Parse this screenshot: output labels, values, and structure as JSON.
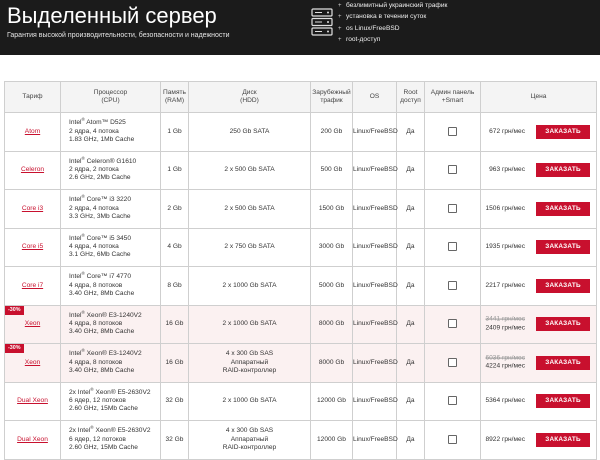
{
  "header": {
    "title": "Выделенный сервер",
    "subtitle": "Гарантия высокой производительности, безопасности и надежности",
    "icon": "server-icon",
    "features": [
      "безлимитный украинский трафик",
      "установка в течении суток",
      "os Linux/FreeBSD",
      "root-доступ"
    ]
  },
  "table": {
    "headers": {
      "tariff": "Тариф",
      "cpu": [
        "Процессор",
        "(CPU)"
      ],
      "ram": [
        "Память",
        "(RAM)"
      ],
      "hdd": [
        "Диск",
        "(HDD)"
      ],
      "traffic": [
        "Зарубежный",
        "трафик"
      ],
      "os": "OS",
      "root": [
        "Root",
        "доступ"
      ],
      "admin": [
        "Админ панель",
        "+Smart"
      ],
      "price": "Цена"
    },
    "order_label": "ЗАКАЗАТЬ",
    "rows": [
      {
        "tariff": "Atom",
        "discount": "",
        "cpu_brand": "Intel",
        "cpu_model": "Atom™ D525",
        "cpu_cores": "2 ядра, 4 потока",
        "cpu_freq": "1.83 GHz, 1Mb Cache",
        "ram": "1 Gb",
        "hdd": [
          "250 Gb SATA"
        ],
        "traffic": "200 Gb",
        "os": "Linux/FreeBSD",
        "root": "Да",
        "old_price": "",
        "price": "672 грн/мес",
        "highlight": false
      },
      {
        "tariff": "Celeron",
        "discount": "",
        "cpu_brand": "Intel",
        "cpu_model": "Celeron® G1610",
        "cpu_cores": "2 ядра, 2 потока",
        "cpu_freq": "2.6 GHz, 2Mb Cache",
        "ram": "1 Gb",
        "hdd": [
          "2 x 500 Gb SATA"
        ],
        "traffic": "500 Gb",
        "os": "Linux/FreeBSD",
        "root": "Да",
        "old_price": "",
        "price": "963 грн/мес",
        "highlight": false
      },
      {
        "tariff": "Core i3",
        "discount": "",
        "cpu_brand": "Intel",
        "cpu_model": "Core™ i3 3220",
        "cpu_cores": "2 ядра, 4 потока",
        "cpu_freq": "3.3 GHz, 3Mb Cache",
        "ram": "2 Gb",
        "hdd": [
          "2 x 500 Gb SATA"
        ],
        "traffic": "1500 Gb",
        "os": "Linux/FreeBSD",
        "root": "Да",
        "old_price": "",
        "price": "1506 грн/мес",
        "highlight": false
      },
      {
        "tariff": "Core i5",
        "discount": "",
        "cpu_brand": "Intel",
        "cpu_model": "Core™ i5 3450",
        "cpu_cores": "4 ядра, 4 потока",
        "cpu_freq": "3.1 GHz, 6Mb Cache",
        "ram": "4 Gb",
        "hdd": [
          "2 x 750 Gb SATA"
        ],
        "traffic": "3000 Gb",
        "os": "Linux/FreeBSD",
        "root": "Да",
        "old_price": "",
        "price": "1935 грн/мес",
        "highlight": false
      },
      {
        "tariff": "Core i7",
        "discount": "",
        "cpu_brand": "Intel",
        "cpu_model": "Core™ i7 4770",
        "cpu_cores": "4 ядра, 8 потоков",
        "cpu_freq": "3.40 GHz, 8Mb Cache",
        "ram": "8 Gb",
        "hdd": [
          "2 x 1000 Gb SATA"
        ],
        "traffic": "5000 Gb",
        "os": "Linux/FreeBSD",
        "root": "Да",
        "old_price": "",
        "price": "2217 грн/мес",
        "highlight": false
      },
      {
        "tariff": "Xeon",
        "discount": "-30%",
        "cpu_brand": "Intel",
        "cpu_model": "Xeon® E3-1240V2",
        "cpu_cores": "4 ядра, 8 потоков",
        "cpu_freq": "3.40 GHz, 8Mb Cache",
        "ram": "16 Gb",
        "hdd": [
          "2 x 1000 Gb SATA"
        ],
        "traffic": "8000 Gb",
        "os": "Linux/FreeBSD",
        "root": "Да",
        "old_price": "3441 грн/мес",
        "price": "2409 грн/мес",
        "highlight": true
      },
      {
        "tariff": "Xeon",
        "discount": "-30%",
        "cpu_brand": "Intel",
        "cpu_model": "Xeon® E3-1240V2",
        "cpu_cores": "4 ядра, 8 потоков",
        "cpu_freq": "3.40 GHz, 8Mb Cache",
        "ram": "16 Gb",
        "hdd": [
          "4 x 300 Gb SAS",
          "Аппаратный",
          "RAID-контроллер"
        ],
        "traffic": "8000 Gb",
        "os": "Linux/FreeBSD",
        "root": "Да",
        "old_price": "6036 грн/мес",
        "price": "4224 грн/мес",
        "highlight": true
      },
      {
        "tariff": "Dual Xeon",
        "discount": "",
        "cpu_brand": "2x Intel",
        "cpu_model": "Xeon® E5-2630V2",
        "cpu_cores": "6 ядер, 12 потоков",
        "cpu_freq": "2.60 GHz, 15Mb Cache",
        "ram": "32 Gb",
        "hdd": [
          "2 x 1000 Gb SATA"
        ],
        "traffic": "12000 Gb",
        "os": "Linux/FreeBSD",
        "root": "Да",
        "old_price": "",
        "price": "5364 грн/мес",
        "highlight": false
      },
      {
        "tariff": "Dual Xeon",
        "discount": "",
        "cpu_brand": "2x Intel",
        "cpu_model": "Xeon® E5-2630V2",
        "cpu_cores": "6 ядер, 12 потоков",
        "cpu_freq": "2.60 GHz, 15Mb Cache",
        "ram": "32 Gb",
        "hdd": [
          "4 x 300 Gb SAS",
          "Аппаратный",
          "RAID-контроллер"
        ],
        "traffic": "12000 Gb",
        "os": "Linux/FreeBSD",
        "root": "Да",
        "old_price": "",
        "price": "8922 грн/мес",
        "highlight": false
      }
    ]
  },
  "colors": {
    "accent": "#c8102e",
    "header_bg": "#1b1b1b",
    "highlight_row": "#fbf1f1"
  }
}
